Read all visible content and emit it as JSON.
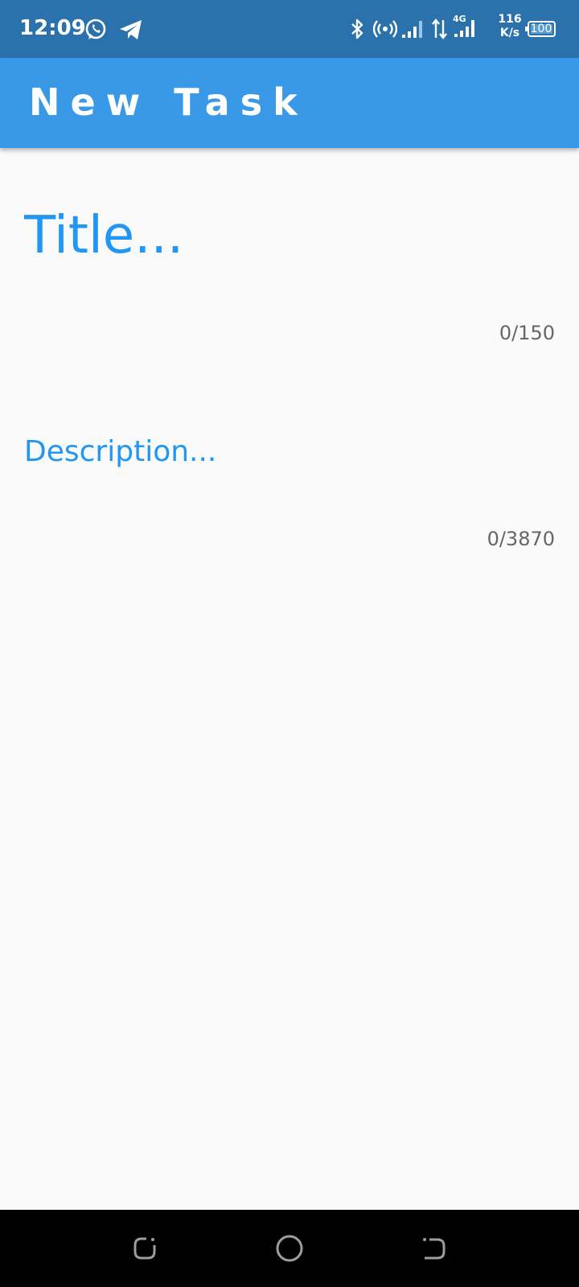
{
  "status_bar": {
    "time": "12:09",
    "network_speed_value": "116",
    "network_speed_unit": "K/s",
    "network_type": "4G",
    "battery_level": "100",
    "icons": [
      "whatsapp-icon",
      "telegram-icon",
      "bluetooth-icon",
      "hotspot-icon",
      "signal-icon",
      "data-transfer-icon",
      "signal-4g-icon",
      "battery-icon"
    ]
  },
  "app_bar": {
    "title": "New Task",
    "background_color": "#3a99e6"
  },
  "form": {
    "title_placeholder": "Title...",
    "title_counter": "0/150",
    "description_placeholder": "Description...",
    "description_counter": "0/3870",
    "accent_color": "#2196f3"
  },
  "nav_bar": {
    "buttons": [
      "recents-icon",
      "home-icon",
      "back-icon"
    ]
  }
}
